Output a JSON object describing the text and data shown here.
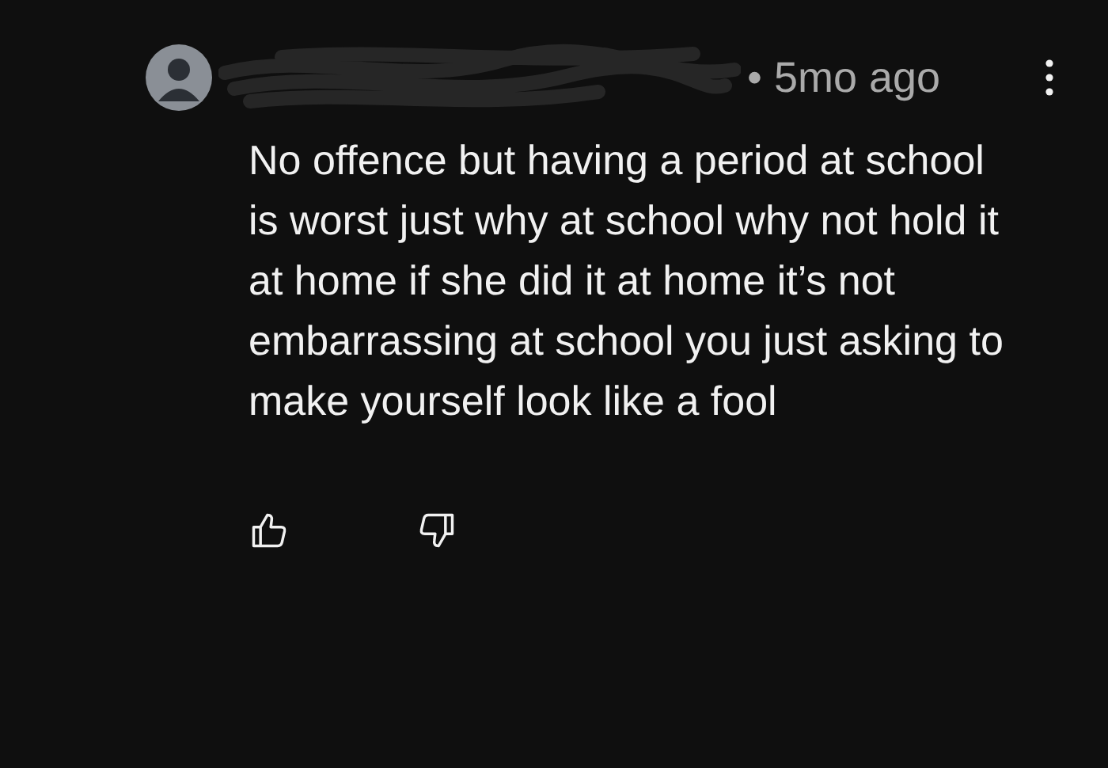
{
  "comment": {
    "time": "• 5mo ago",
    "text": "No offence but having a period at school is worst just why at school why not hold it at home if she did it at home it’s not embarrassing at school you just asking to make yourself look like a fool"
  }
}
